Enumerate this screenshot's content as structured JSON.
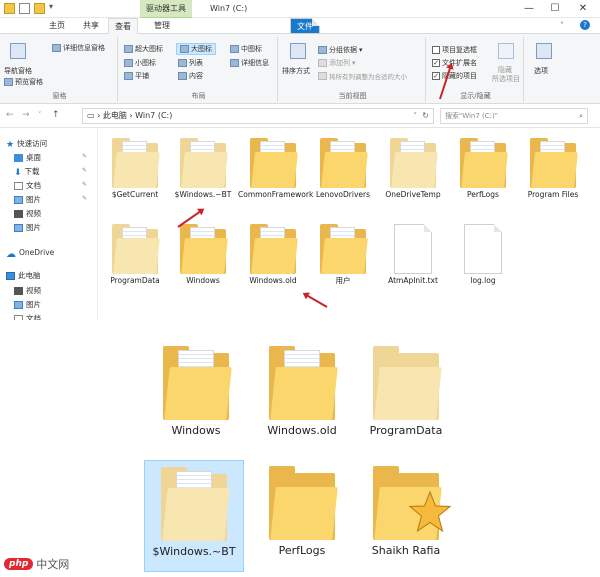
{
  "window": {
    "title": "Win7 (C:)",
    "context_tab": "驱动器工具",
    "minimize": "—",
    "maximize": "☐",
    "close": "✕"
  },
  "tabs": {
    "file": "文件",
    "home": "主页",
    "share": "共享",
    "view": "查看",
    "manage": "管理"
  },
  "ribbon": {
    "pane": {
      "nav_pane": "导航窗格",
      "preview_pane": "预览窗格",
      "details_pane": "详细信息窗格",
      "label": "窗格"
    },
    "layout": {
      "xl_icons": "超大图标",
      "large_icons": "大图标",
      "medium_icons": "中图标",
      "small_icons": "小图标",
      "list": "列表",
      "details": "详细信息",
      "tiles": "平铺",
      "content": "内容",
      "label": "布局"
    },
    "current_view": {
      "sort_by": "排序方式",
      "group_by": "分组依据",
      "add_columns": "添加列",
      "size_all_columns": "将所有列调整为合适的大小",
      "label": "当前视图"
    },
    "show_hide": {
      "item_checkboxes": "项目复选框",
      "file_extensions": "文件扩展名",
      "hidden_items": "隐藏的项目",
      "hide_selected": "隐藏",
      "hide_selected_2": "所选项目",
      "label": "显示/隐藏",
      "options": "选项"
    }
  },
  "address": {
    "path_root": "此电脑",
    "path_current": "Win7 (C:)",
    "search_placeholder": "搜索\"Win7 (C:)\""
  },
  "nav": {
    "quick_access": "快速访问",
    "desktop": "桌面",
    "downloads": "下载",
    "documents": "文档",
    "pictures": "图片",
    "videos": "视频",
    "onedrive": "OneDrive",
    "this_pc": "此电脑",
    "pc_videos": "视频",
    "pc_pictures": "图片",
    "pc_documents": "文档"
  },
  "files": [
    {
      "name": "$GetCurrent",
      "type": "folder"
    },
    {
      "name": "$Windows.~BT",
      "type": "folder"
    },
    {
      "name": "CommonFramework",
      "type": "folder"
    },
    {
      "name": "LenovoDrivers",
      "type": "folder"
    },
    {
      "name": "OneDriveTemp",
      "type": "folder"
    },
    {
      "name": "PerfLogs",
      "type": "folder"
    },
    {
      "name": "Program Files",
      "type": "folder"
    },
    {
      "name": "ProgramData",
      "type": "folder"
    },
    {
      "name": "Windows",
      "type": "folder"
    },
    {
      "name": "Windows.old",
      "type": "folder"
    },
    {
      "name": "用户",
      "type": "folder"
    },
    {
      "name": "AtmApInit.txt",
      "type": "file"
    },
    {
      "name": "log.log",
      "type": "file"
    }
  ],
  "large_items": [
    {
      "name": "Windows"
    },
    {
      "name": "Windows.old"
    },
    {
      "name": "ProgramData"
    },
    {
      "name": "$Windows.~BT"
    },
    {
      "name": "PerfLogs"
    },
    {
      "name": "Shaikh Rafia"
    }
  ],
  "watermark": {
    "logo": "php",
    "text": "中文网"
  },
  "colors": {
    "accent": "#1979ca",
    "folder": "#fbd66c",
    "arrow": "#c8252b",
    "selection": "#cce8ff"
  }
}
